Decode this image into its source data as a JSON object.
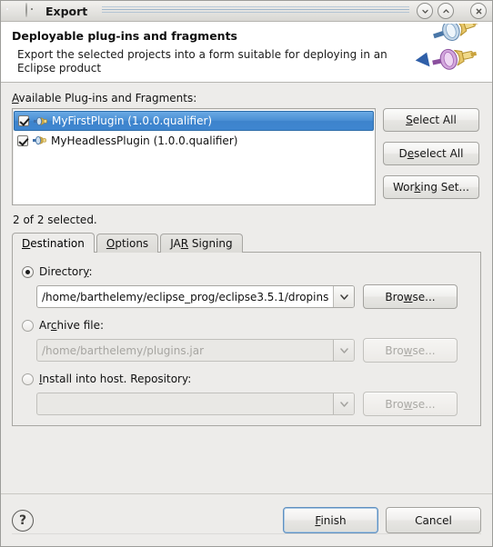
{
  "window": {
    "title": "Export",
    "icons": {
      "app": "eclipse-icon",
      "menu": "window-menu-icon",
      "minimize": "chevron-down-icon",
      "maximize": "chevron-up-icon",
      "close": "close-icon"
    }
  },
  "banner": {
    "title": "Deployable plug-ins and fragments",
    "description": "Export the selected projects into a form suitable for deploying in an Eclipse product",
    "art": "plug-connectors-icon"
  },
  "plugins": {
    "label": "Available Plug-ins and Fragments:",
    "label_mnemonic": "A",
    "items": [
      {
        "name": "MyFirstPlugin (1.0.0.qualifier)",
        "checked": true,
        "selected": true,
        "icon": "plugin-icon"
      },
      {
        "name": "MyHeadlessPlugin (1.0.0.qualifier)",
        "checked": true,
        "selected": false,
        "icon": "plugin-icon"
      }
    ],
    "selection_info": "2 of 2 selected."
  },
  "side_buttons": [
    {
      "label": "Select All",
      "mnemonic": "S",
      "enabled": true
    },
    {
      "label": "Deselect All",
      "mnemonic": "e",
      "enabled": true
    },
    {
      "label": "Working Set...",
      "mnemonic": "k",
      "enabled": true
    }
  ],
  "tabs": [
    {
      "label": "Destination",
      "mnemonic": "D",
      "active": true
    },
    {
      "label": "Options",
      "mnemonic": "O",
      "active": false
    },
    {
      "label": "JAR Signing",
      "mnemonic": "R",
      "active": false
    }
  ],
  "destination": {
    "options": [
      {
        "label": "Directory:",
        "selected": true,
        "value": "/home/barthelemy/eclipse_prog/eclipse3.5.1/dropins",
        "placeholder": "",
        "enabled": true,
        "browse_label": "Browse...",
        "browse_enabled": true
      },
      {
        "label": "Archive file:",
        "selected": false,
        "value": "/home/barthelemy/plugins.jar",
        "placeholder": "",
        "enabled": false,
        "browse_label": "Browse...",
        "browse_enabled": false
      },
      {
        "label": "Install into host. Repository:",
        "selected": false,
        "value": "",
        "placeholder": "",
        "enabled": false,
        "browse_label": "Browse...",
        "browse_enabled": false
      }
    ]
  },
  "footer": {
    "help_icon": "help-icon",
    "finish_label": "Finish",
    "finish_mnemonic": "F",
    "cancel_label": "Cancel",
    "finish_is_default": true
  },
  "colors": {
    "selection_blue": "#4a8fd4",
    "window_bg": "#edecea",
    "banner_bg": "#ffffff",
    "default_button_border": "#5f90c0"
  }
}
